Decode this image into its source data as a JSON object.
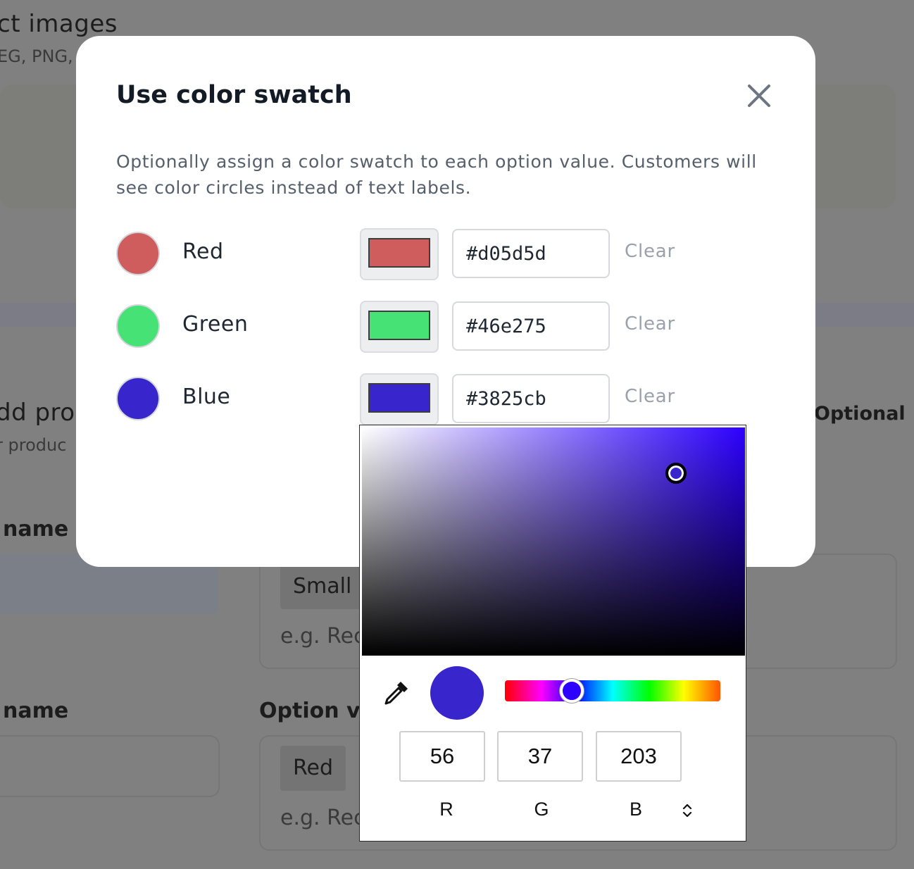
{
  "background": {
    "title_fragment": "ct images",
    "subtitle_fragment": "EG, PNG,",
    "section_title_fragment": "dd pro",
    "section_sub_fragment": "r produc",
    "optional_label": "Optional",
    "label_1": "name",
    "label_2": "name",
    "option_values_label": "Option va",
    "chip_1": "Small",
    "chip_2": "Red",
    "placeholder_1": "e.g. Rec",
    "placeholder_2": "e.g. Rec"
  },
  "modal": {
    "title": "Use color swatch",
    "description": "Optionally assign a color swatch to each option value. Customers will see color circles instead of text labels.",
    "rows": [
      {
        "label": "Red",
        "hex": "#d05d5d",
        "clear_label": "Clear"
      },
      {
        "label": "Green",
        "hex": "#46e275",
        "clear_label": "Clear"
      },
      {
        "label": "Blue",
        "hex": "#3825cb",
        "clear_label": "Clear"
      }
    ]
  },
  "picker": {
    "current_color": "#3825cb",
    "hue_base_color": "#2d00ff",
    "saturation": 0.82,
    "brightness": 0.8,
    "hue_position": 0.31,
    "r": "56",
    "g": "37",
    "b": "203",
    "labels": {
      "r": "R",
      "g": "G",
      "b": "B"
    }
  },
  "icons": {
    "close": "close-icon",
    "eyedropper": "eyedropper-icon",
    "mode_toggle": "chevron-up-down-icon"
  }
}
